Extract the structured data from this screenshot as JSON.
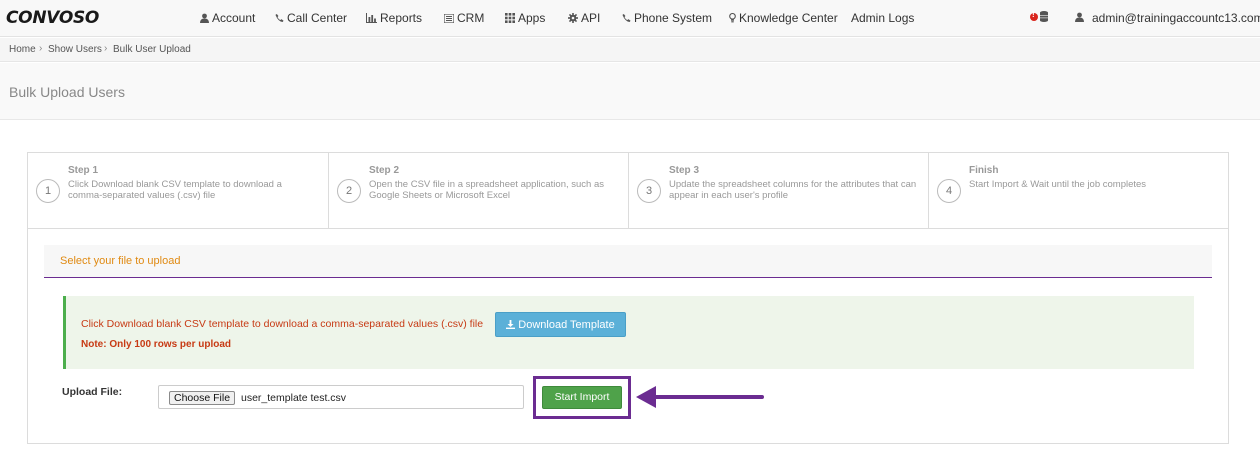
{
  "brand": {
    "logo_text": "CONVOSO"
  },
  "nav": {
    "items": [
      {
        "label": "Account",
        "icon": "user-icon"
      },
      {
        "label": "Call Center",
        "icon": "phone-icon"
      },
      {
        "label": "Reports",
        "icon": "bar-chart-icon"
      },
      {
        "label": "CRM",
        "icon": "list-icon"
      },
      {
        "label": "Apps",
        "icon": "grid-icon"
      },
      {
        "label": "API",
        "icon": "gear-icon"
      },
      {
        "label": "Phone System",
        "icon": "phone-icon"
      },
      {
        "label": "Knowledge Center",
        "icon": "lightbulb-icon"
      },
      {
        "label": "Admin Logs",
        "icon": ""
      }
    ],
    "user_email": "admin@trainingaccountc13.com"
  },
  "breadcrumb": [
    "Home",
    "Show Users",
    "Bulk User Upload"
  ],
  "page": {
    "title": "Bulk Upload Users"
  },
  "steps": [
    {
      "number": "1",
      "title": "Step 1",
      "desc": "Click Download blank CSV template to download a comma-separated values (.csv) file"
    },
    {
      "number": "2",
      "title": "Step 2",
      "desc": "Open the CSV file in a spreadsheet application, such as Google Sheets or Microsoft Excel"
    },
    {
      "number": "3",
      "title": "Step 3",
      "desc": "Update the spreadsheet columns for the attributes that can appear in each user's profile"
    },
    {
      "number": "4",
      "title": "Finish",
      "desc": "Start Import & Wait until the job completes"
    }
  ],
  "upload": {
    "section_title": "Select your file to upload",
    "info_text": "Click Download blank CSV template to download a comma-separated values (.csv) file",
    "note": "Note: Only 100 rows per upload",
    "download_label": "Download Template",
    "file_label": "Upload File:",
    "choose_label": "Choose File",
    "file_name": "user_template test.csv",
    "start_label": "Start Import"
  },
  "colors": {
    "accent_purple": "#6b2c91",
    "success_green": "#4fa24a",
    "info_blue": "#5bb0d8",
    "warning_orange": "#e08a12",
    "danger_red": "#c73a14"
  }
}
